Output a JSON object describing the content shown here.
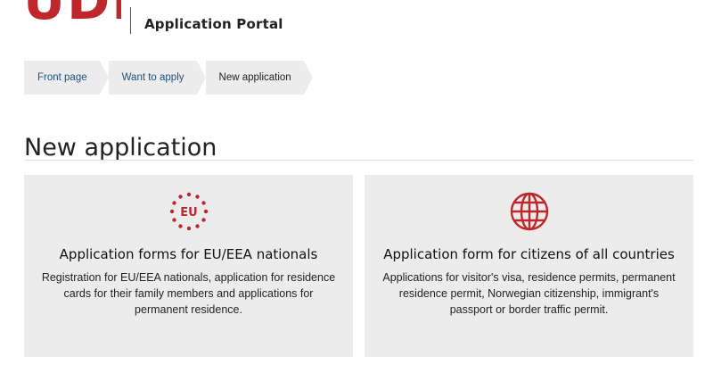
{
  "header": {
    "logo_text": "UDI",
    "portal_title": "Application Portal"
  },
  "breadcrumb": [
    {
      "label": "Front page"
    },
    {
      "label": "Want to apply"
    },
    {
      "label": "New application"
    }
  ],
  "page": {
    "title": "New application"
  },
  "cards": [
    {
      "icon": "eu-stars-icon",
      "icon_text": "EU",
      "title": "Application forms for EU/EEA nationals",
      "description": "Registration for EU/EEA nationals, application for residence cards for their family members and applications for permanent residence."
    },
    {
      "icon": "globe-icon",
      "title": "Application form for citizens of all countries",
      "description": "Applications for visitor's visa, residence permits, permanent residence permit, Norwegian citizenship, immigrant's passport or border traffic permit."
    }
  ],
  "colors": {
    "brand_red": "#c0272d",
    "link_blue": "#1f4f7a",
    "card_bg": "#ececec"
  }
}
